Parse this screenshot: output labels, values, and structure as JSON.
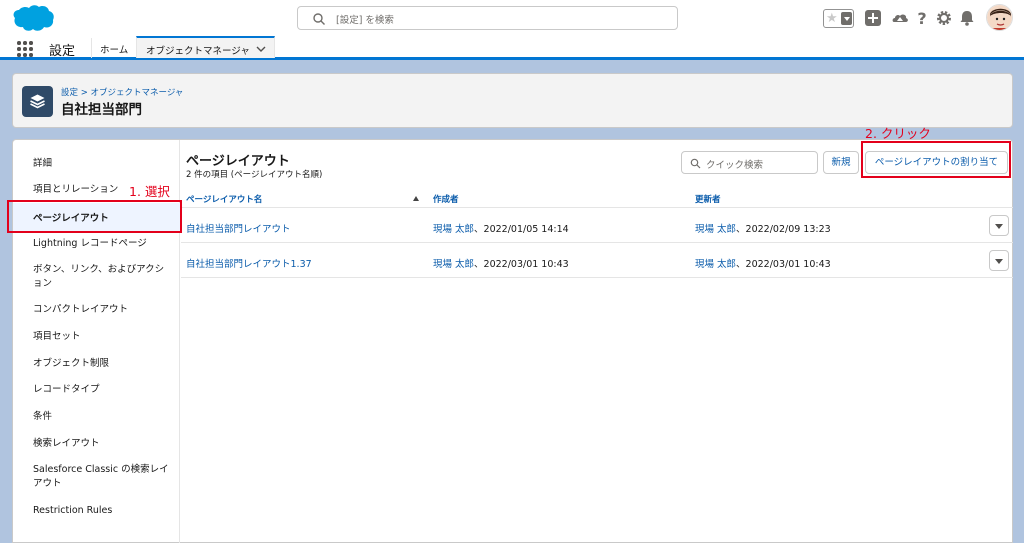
{
  "colors": {
    "brand": "#0176d3",
    "link": "#0b5cab",
    "annotation": "#e3001b"
  },
  "global_header": {
    "search_placeholder": "[設定] を検索",
    "icons": [
      "salesforce-logo",
      "favorites-star-icon",
      "add-icon",
      "trailhead-icon",
      "help-icon",
      "setup-gear-icon",
      "notification-bell-icon",
      "user-avatar"
    ]
  },
  "context_bar": {
    "app_name": "設定",
    "tabs": [
      {
        "label": "ホーム"
      },
      {
        "label": "オブジェクトマネージャ",
        "active": true
      }
    ]
  },
  "page_header": {
    "breadcrumb": "設定 > オブジェクトマネージャ",
    "title": "自社担当部門",
    "icon": "layers-icon"
  },
  "sidebar": {
    "items": [
      {
        "label": "詳細"
      },
      {
        "label": "項目とリレーション"
      },
      {
        "label": "ページレイアウト",
        "selected": true
      },
      {
        "label": "Lightning レコードページ"
      },
      {
        "label": "ボタン、リンク、およびアクション"
      },
      {
        "label": "コンパクトレイアウト"
      },
      {
        "label": "項目セット"
      },
      {
        "label": "オブジェクト制限"
      },
      {
        "label": "レコードタイプ"
      },
      {
        "label": "条件"
      },
      {
        "label": "検索レイアウト"
      },
      {
        "label": "Salesforce Classic の検索レイアウト"
      },
      {
        "label": "Restriction Rules"
      }
    ]
  },
  "list": {
    "title": "ページレイアウト",
    "subtitle": "2 件の項目 (ページレイアウト名順)",
    "quick_search_placeholder": "クイック検索",
    "new_button": "新規",
    "assign_button": "ページレイアウトの割り当て",
    "columns": [
      "ページレイアウト名",
      "作成者",
      "更新者"
    ],
    "rows": [
      {
        "name": "自社担当部門レイアウト",
        "created_by": "現場 太郎",
        "created_at": "、2022/01/05 14:14",
        "modified_by": "現場 太郎",
        "modified_at": "、2022/02/09 13:23"
      },
      {
        "name": "自社担当部門レイアウト1.37",
        "created_by": "現場 太郎",
        "created_at": "、2022/03/01 10:43",
        "modified_by": "現場 太郎",
        "modified_at": "、2022/03/01 10:43"
      }
    ]
  },
  "annotations": {
    "step1": "1. 選択",
    "step2": "2. クリック"
  }
}
